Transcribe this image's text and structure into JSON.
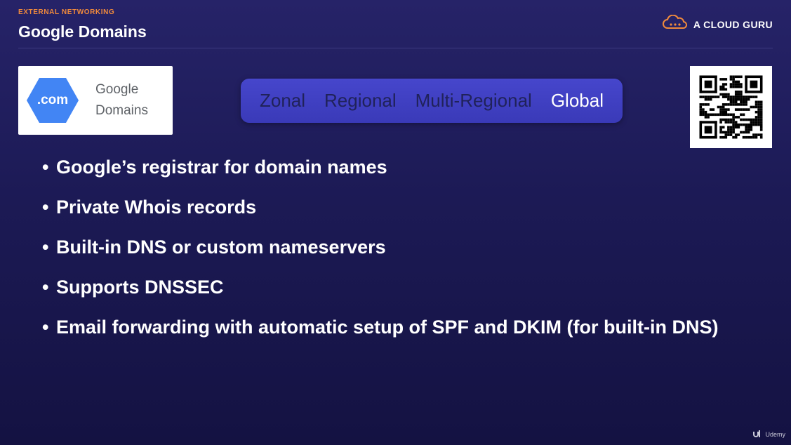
{
  "header": {
    "section_label": "EXTERNAL NETWORKING",
    "title": "Google Domains",
    "brand": "A CLOUD GURU"
  },
  "logo": {
    "badge": ".com",
    "name_line1": "Google",
    "name_line2": "Domains"
  },
  "scope": {
    "items": [
      "Zonal",
      "Regional",
      "Multi-Regional",
      "Global"
    ],
    "active": "Global"
  },
  "bullets": [
    "Google’s registrar for domain names",
    "Private Whois records",
    "Built-in DNS or custom nameservers",
    "Supports DNSSEC",
    "Email forwarding with automatic setup of SPF and DKIM (for built-in DNS)"
  ],
  "watermark": "Udemy",
  "colors": {
    "accent_orange": "#f08a3c",
    "scope_bar": "#4040c0",
    "logo_blue": "#4285f4",
    "background": "#1c1a55"
  },
  "icons": [
    "cloud-icon",
    "domain-hex-icon",
    "qr-code",
    "udemy-icon"
  ]
}
